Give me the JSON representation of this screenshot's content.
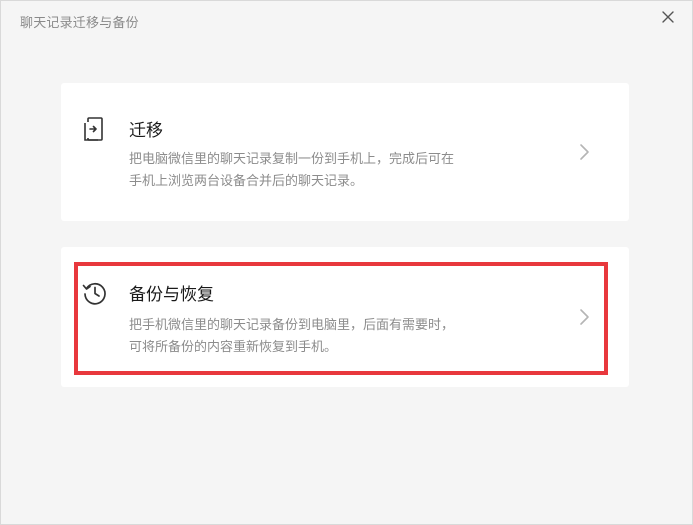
{
  "window": {
    "title": "聊天记录迁移与备份"
  },
  "cards": {
    "migrate": {
      "title": "迁移",
      "desc_line1": "把电脑微信里的聊天记录复制一份到手机上，完成后可在",
      "desc_line2": "手机上浏览两台设备合并后的聊天记录。",
      "icon": "phone-import-icon"
    },
    "backup": {
      "title": "备份与恢复",
      "desc_line1": "把手机微信里的聊天记录备份到电脑里，后面有需要时，",
      "desc_line2": "可将所备份的内容重新恢复到手机。",
      "icon": "history-clock-icon"
    }
  },
  "colors": {
    "highlight": "#e8383d",
    "background": "#f5f5f5",
    "card": "#ffffff"
  }
}
